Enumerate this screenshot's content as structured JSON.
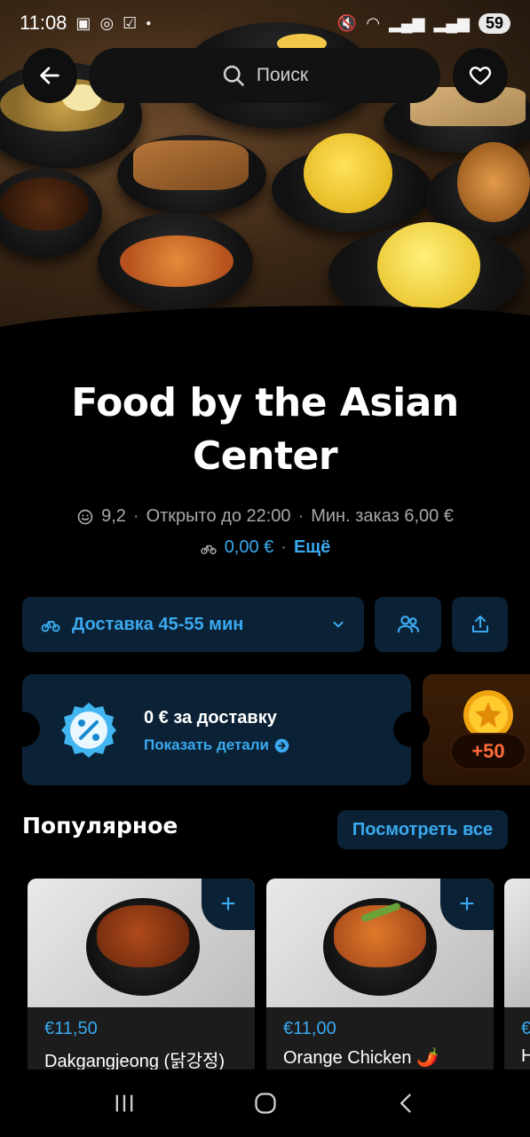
{
  "status_bar": {
    "time": "11:08",
    "battery": "59"
  },
  "search": {
    "placeholder": "Поиск"
  },
  "restaurant": {
    "name": "Food by the Asian Center",
    "rating": "9,2",
    "open_until": "Открыто до 22:00",
    "min_order": "Мин. заказ 6,00 €",
    "delivery_fee": "0,00 €",
    "more_link": "Ещё"
  },
  "actions": {
    "delivery_label": "Доставка 45-55 мин"
  },
  "promo": {
    "title": "0 € за доставку",
    "details_link": "Показать детали",
    "coins": "+50"
  },
  "popular": {
    "title": "Популярное",
    "see_all": "Посмотреть все",
    "items": [
      {
        "price": "€11,50",
        "name": "Dakgangjeong (닭강정)"
      },
      {
        "price": "€11,00",
        "name": "Orange Chicken 🌶️"
      },
      {
        "price": "€",
        "name": "H"
      }
    ]
  },
  "colors": {
    "accent": "#3aa9ef",
    "panel": "#0b2236",
    "coins": "#ff6a3a"
  }
}
